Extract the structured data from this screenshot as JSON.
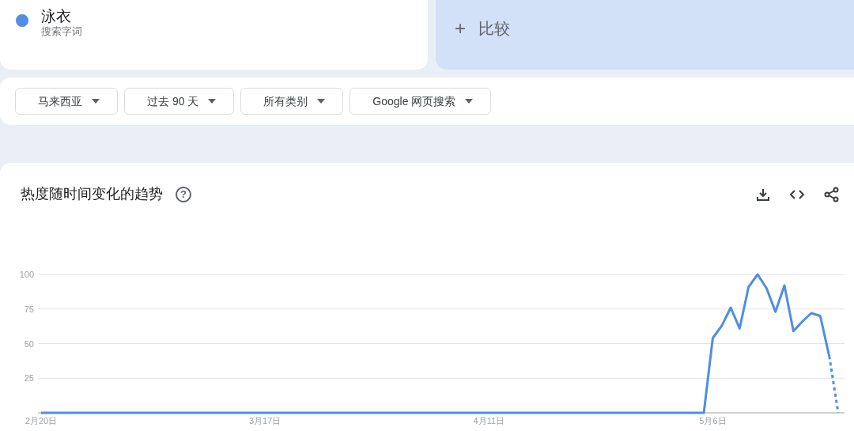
{
  "term": {
    "subtitle": "搜索字词"
  },
  "compare": {
    "icon": "+",
    "label": "比较"
  },
  "filters": [
    {
      "label": "马来西亚"
    },
    {
      "label": "过去 90 天"
    },
    {
      "label": "所有类别"
    },
    {
      "label": "Google 网页搜索"
    }
  ],
  "panel": {
    "title": "热度随时间变化的趋势",
    "help": "?",
    "chart_data": {
      "type": "line",
      "grid": true,
      "ylim": [
        0,
        100
      ],
      "yticks": [
        25,
        50,
        75,
        100
      ],
      "categories": [
        "2月20日",
        null,
        null,
        null,
        null,
        null,
        null,
        null,
        null,
        null,
        null,
        null,
        null,
        null,
        null,
        null,
        null,
        null,
        null,
        null,
        null,
        null,
        null,
        null,
        null,
        "3月17日",
        null,
        null,
        null,
        null,
        null,
        null,
        null,
        null,
        null,
        null,
        null,
        null,
        null,
        null,
        null,
        null,
        null,
        null,
        null,
        null,
        null,
        null,
        null,
        null,
        "4月11日",
        null,
        null,
        null,
        null,
        null,
        null,
        null,
        null,
        null,
        null,
        null,
        null,
        null,
        null,
        null,
        null,
        null,
        null,
        null,
        null,
        null,
        null,
        null,
        null,
        "5月6日",
        null,
        null,
        null,
        null,
        null,
        null,
        null,
        null,
        null,
        null,
        null,
        null,
        null,
        null
      ],
      "series": [
        {
          "name": "泳衣",
          "color": "#4f8ee2",
          "values": [
            0,
            0,
            0,
            0,
            0,
            0,
            0,
            0,
            0,
            0,
            0,
            0,
            0,
            0,
            0,
            0,
            0,
            0,
            0,
            0,
            0,
            0,
            0,
            0,
            0,
            0,
            0,
            0,
            0,
            0,
            0,
            0,
            0,
            0,
            0,
            0,
            0,
            0,
            0,
            0,
            0,
            0,
            0,
            0,
            0,
            0,
            0,
            0,
            0,
            0,
            0,
            0,
            0,
            0,
            0,
            0,
            0,
            0,
            0,
            0,
            0,
            0,
            0,
            0,
            0,
            0,
            0,
            0,
            0,
            0,
            0,
            0,
            0,
            0,
            0,
            54,
            63,
            76,
            61,
            91,
            100,
            90,
            73,
            92,
            59,
            66,
            72,
            70,
            41,
            null
          ]
        },
        {
          "color": "#4f8ee2",
          "line_style": "dashed",
          "values": [
            null,
            null,
            null,
            null,
            null,
            null,
            null,
            null,
            null,
            null,
            null,
            null,
            null,
            null,
            null,
            null,
            null,
            null,
            null,
            null,
            null,
            null,
            null,
            null,
            null,
            null,
            null,
            null,
            null,
            null,
            null,
            null,
            null,
            null,
            null,
            null,
            null,
            null,
            null,
            null,
            null,
            null,
            null,
            null,
            null,
            null,
            null,
            null,
            null,
            null,
            null,
            null,
            null,
            null,
            null,
            null,
            null,
            null,
            null,
            null,
            null,
            null,
            null,
            null,
            null,
            null,
            null,
            null,
            null,
            null,
            null,
            null,
            null,
            null,
            null,
            null,
            null,
            null,
            null,
            null,
            null,
            null,
            null,
            null,
            null,
            null,
            null,
            null,
            41,
            0
          ]
        }
      ]
    }
  }
}
